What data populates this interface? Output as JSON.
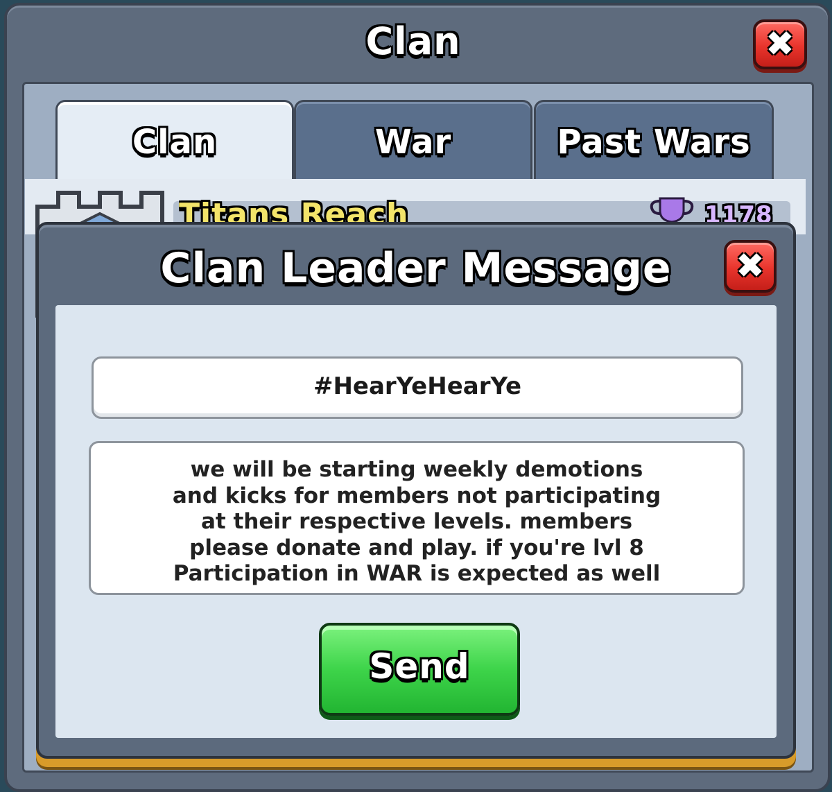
{
  "background_panel": {
    "title": "Clan",
    "close_icon": "close-x-icon",
    "tabs": [
      {
        "label": "Clan",
        "active": true
      },
      {
        "label": "War",
        "active": false
      },
      {
        "label": "Past Wars",
        "active": false
      }
    ],
    "clan_name": "Titans Reach",
    "trophy_count": "1178",
    "trophy_icon": "trophy-icon",
    "badge_icon": "castle-badge-icon"
  },
  "modal": {
    "title": "Clan Leader Message",
    "close_icon": "close-x-icon",
    "subject_value": "#HearYeHearYe",
    "message_value": "we will be starting weekly demotions\nand kicks for members not participating\nat their respective levels. members\nplease donate and play. if you're lvl 8\nParticipation in WAR is expected as well",
    "send_label": "Send"
  },
  "colors": {
    "panel": "#5e6b7d",
    "close_button": "#e8342c",
    "send_button": "#3ed44a",
    "clan_name": "#f3e46a",
    "accent_gold": "#d89b2a"
  }
}
